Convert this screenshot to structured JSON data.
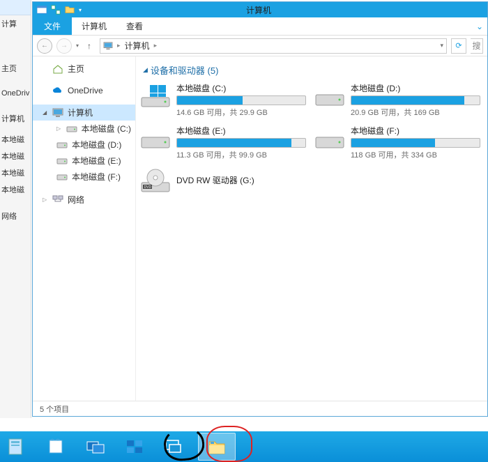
{
  "window": {
    "title": "计算机"
  },
  "ribbon": {
    "file": "文件",
    "tab_computer": "计算机",
    "tab_view": "查看"
  },
  "address": {
    "location": "计算机"
  },
  "bgwin": {
    "a": "计算",
    "b": "主页",
    "c": "OneDriv",
    "d": "计算机",
    "e": "本地磁",
    "f": "本地磁",
    "g": "本地磁",
    "h": "本地磁",
    "i": "网络"
  },
  "nav": {
    "home": "主页",
    "onedrive": "OneDrive",
    "computer": "计算机",
    "drives": {
      "c": "本地磁盘 (C:)",
      "d": "本地磁盘 (D:)",
      "e": "本地磁盘 (E:)",
      "f": "本地磁盘 (F:)"
    },
    "network": "网络"
  },
  "group": {
    "header": "设备和驱动器 (5)"
  },
  "drives": [
    {
      "name": "本地磁盘 (C:)",
      "free": 14.6,
      "total": 29.9,
      "stat": "14.6 GB 可用，共 29.9 GB",
      "fill_pct": 51
    },
    {
      "name": "本地磁盘 (D:)",
      "free": 20.9,
      "total": 169,
      "stat": "20.9 GB 可用，共 169 GB",
      "fill_pct": 88
    },
    {
      "name": "本地磁盘 (E:)",
      "free": 11.3,
      "total": 99.9,
      "stat": "11.3 GB 可用，共 99.9 GB",
      "fill_pct": 89
    },
    {
      "name": "本地磁盘 (F:)",
      "free": 118,
      "total": 334,
      "stat": "118 GB 可用，共 334 GB",
      "fill_pct": 65
    }
  ],
  "optical": {
    "name": "DVD RW 驱动器 (G:)"
  },
  "status": {
    "text": "5 个项目"
  }
}
